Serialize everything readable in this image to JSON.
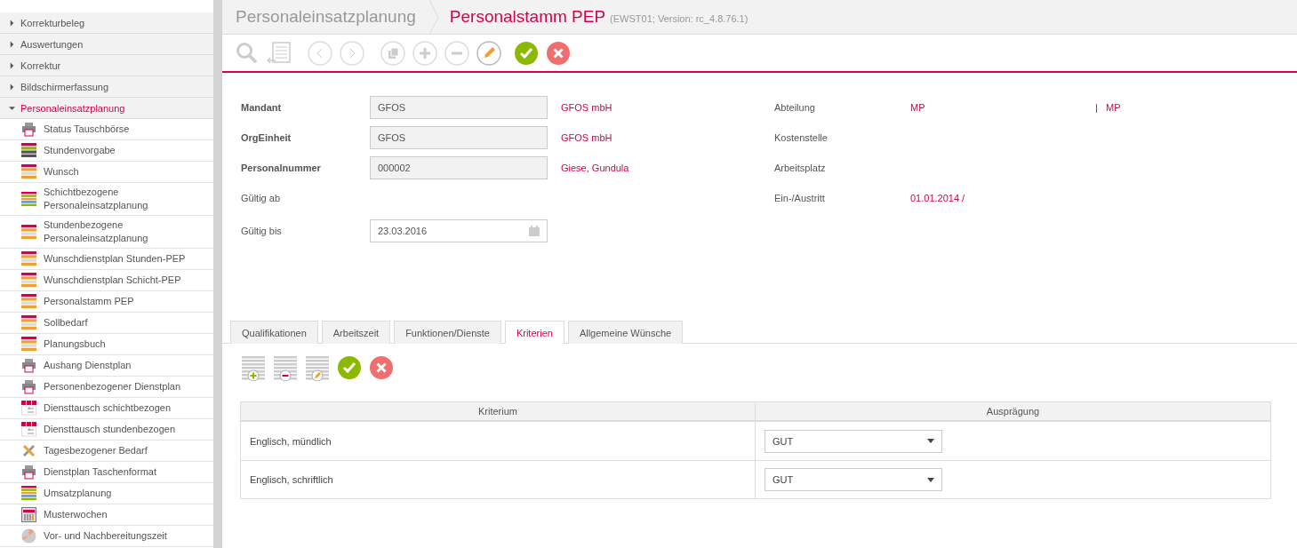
{
  "sidebar": {
    "items": [
      {
        "label": "Korrekturbeleg",
        "expanded": false
      },
      {
        "label": "Auswertungen",
        "expanded": false
      },
      {
        "label": "Korrektur",
        "expanded": false
      },
      {
        "label": "Bildschirmerfassung",
        "expanded": false
      },
      {
        "label": "Personaleinsatzplanung",
        "expanded": true,
        "children": [
          {
            "label": "Status Tauschbörse",
            "kind": "printer"
          },
          {
            "label": "Stundenvorgabe",
            "kind": "dots"
          },
          {
            "label": "Wunsch",
            "kind": "grid"
          },
          {
            "label": "Schichtbezogene Personaleinsatzplanung",
            "kind": "bars"
          },
          {
            "label": "Stundenbezogene Personaleinsatzplanung",
            "kind": "grid"
          },
          {
            "label": "Wunschdienstplan Stunden-PEP",
            "kind": "grid"
          },
          {
            "label": "Wunschdienstplan Schicht-PEP",
            "kind": "grid"
          },
          {
            "label": "Personalstamm PEP",
            "kind": "grid"
          },
          {
            "label": "Sollbedarf",
            "kind": "grid"
          },
          {
            "label": "Planungsbuch",
            "kind": "grid"
          },
          {
            "label": "Aushang Dienstplan",
            "kind": "printer"
          },
          {
            "label": "Personenbezogener Dienstplan",
            "kind": "printer"
          },
          {
            "label": "Diensttausch schichtbezogen",
            "kind": "swap"
          },
          {
            "label": "Diensttausch stundenbezogen",
            "kind": "swap"
          },
          {
            "label": "Tagesbezogener Bedarf",
            "kind": "wrench"
          },
          {
            "label": "Dienstplan Taschenformat",
            "kind": "printer"
          },
          {
            "label": "Umsatzplanung",
            "kind": "bars"
          },
          {
            "label": "Musterwochen",
            "kind": "calendar"
          },
          {
            "label": "Vor- und Nachbereitungszeit",
            "kind": "pie"
          }
        ]
      }
    ]
  },
  "header": {
    "breadcrumb": "Personaleinsatzplanung",
    "title": "Personalstamm PEP",
    "version": "(EWST01; Version: rc_4.8.76.1)"
  },
  "toolbar": [
    {
      "kind": "search",
      "disabled": true
    },
    {
      "kind": "list",
      "disabled": true
    },
    {
      "kind": "prev",
      "disabled": true
    },
    {
      "kind": "next",
      "disabled": true
    },
    {
      "kind": "copy",
      "disabled": true
    },
    {
      "kind": "add",
      "disabled": true
    },
    {
      "kind": "remove",
      "disabled": true
    },
    {
      "kind": "edit",
      "disabled": false
    },
    {
      "kind": "confirm",
      "disabled": false
    },
    {
      "kind": "cancel",
      "disabled": false
    }
  ],
  "form": {
    "left": [
      {
        "label": "Mandant",
        "required": true,
        "kind": "readonly",
        "value": "GFOS",
        "link": "GFOS mbH"
      },
      {
        "label": "OrgEinheit",
        "required": true,
        "kind": "readonly",
        "value": "GFOS",
        "link": "GFOS mbH"
      },
      {
        "label": "Personalnummer",
        "required": true,
        "kind": "readonly",
        "value": "000002",
        "link": "Giese, Gundula"
      },
      {
        "label": "Gültig ab",
        "required": false,
        "kind": "none"
      },
      {
        "label": "Gültig bis",
        "required": false,
        "kind": "date",
        "value": "23.03.2016"
      }
    ],
    "right": [
      {
        "label": "Abteilung",
        "value": "MP",
        "separator": "|",
        "extra": "MP"
      },
      {
        "label": "Kostenstelle"
      },
      {
        "label": "Arbeitsplatz"
      },
      {
        "label": "Ein-/Austritt",
        "value": "01.01.2014 /"
      }
    ]
  },
  "tabs": [
    {
      "label": "Qualifikationen",
      "selected": false
    },
    {
      "label": "Arbeitszeit",
      "selected": false
    },
    {
      "label": "Funktionen/Dienste",
      "selected": false
    },
    {
      "label": "Kriterien",
      "selected": true
    },
    {
      "label": "Allgemeine Wünsche",
      "selected": false
    }
  ],
  "subtoolbar": [
    {
      "kind": "add-row"
    },
    {
      "kind": "remove-row"
    },
    {
      "kind": "edit-row"
    },
    {
      "kind": "confirm"
    },
    {
      "kind": "cancel"
    }
  ],
  "table": {
    "columns": [
      "Kriterium",
      "Ausprägung"
    ],
    "rows": [
      {
        "criterion": "Englisch, mündlich",
        "value": "GUT"
      },
      {
        "criterion": "Englisch, schriftlich",
        "value": "GUT"
      }
    ]
  }
}
